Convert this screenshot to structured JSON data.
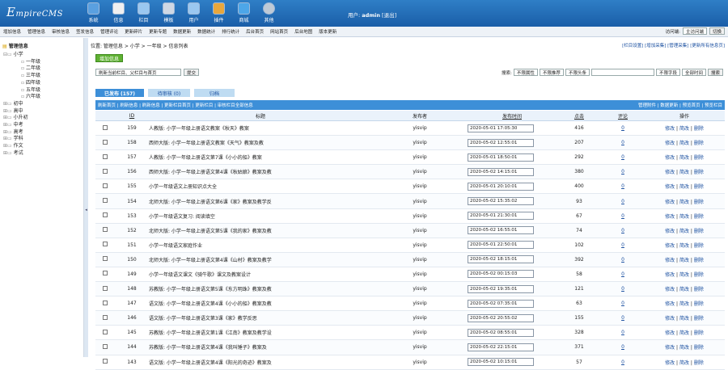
{
  "header": {
    "logo_main": "E",
    "logo_rest": "mpireCMS",
    "nav": [
      {
        "label": "系统",
        "icon": "monitor-icon"
      },
      {
        "label": "信息",
        "icon": "edit-icon"
      },
      {
        "label": "栏目",
        "icon": "folder-icon"
      },
      {
        "label": "模板",
        "icon": "template-icon"
      },
      {
        "label": "用户",
        "icon": "user-icon"
      },
      {
        "label": "插件",
        "icon": "tools-icon"
      },
      {
        "label": "商城",
        "icon": "cart-icon"
      },
      {
        "label": "其他",
        "icon": "gear-icon"
      }
    ],
    "user_prefix": "用户:",
    "user_name": "admin",
    "logout": "[退出]"
  },
  "subnav": {
    "items": [
      "增加信息",
      "管理信息",
      "审核信息",
      "签发信息",
      "管理评论",
      "更新碎片",
      "更新专题",
      "数据更新",
      "数据统计",
      "排行统计",
      "后台首页",
      "网站首页",
      "后台地图",
      "版本更新"
    ],
    "lang_label": "访问端:",
    "lang_value": "主访问端",
    "switch_label": "切换"
  },
  "sidebar": {
    "root": "管理信息",
    "tree": [
      {
        "label": "小学",
        "level": 0,
        "open": true
      },
      {
        "label": "一年级",
        "level": 1
      },
      {
        "label": "二年级",
        "level": 1
      },
      {
        "label": "三年级",
        "level": 1
      },
      {
        "label": "四年级",
        "level": 1
      },
      {
        "label": "五年级",
        "level": 1
      },
      {
        "label": "六年级",
        "level": 1
      },
      {
        "label": "初中",
        "level": 0
      },
      {
        "label": "高中",
        "level": 0
      },
      {
        "label": "小升初",
        "level": 0
      },
      {
        "label": "中考",
        "level": 0
      },
      {
        "label": "高考",
        "level": 0
      },
      {
        "label": "学科",
        "level": 0
      },
      {
        "label": "作文",
        "level": 0
      },
      {
        "label": "考试",
        "level": 0
      }
    ]
  },
  "main": {
    "breadcrumb": "位置: 管理信息 > 小学 > 一年级 > 信息列表",
    "top_links": "[栏目设置] [增加采集] [管理采集] [更新所有信息页]",
    "add_button": "增加信息",
    "filter_select": "刷新当前栏目、父栏目与首页",
    "filter_submit": "提交",
    "search": {
      "label": "搜索:",
      "sel1": "不限属性",
      "sel2": "不限推荐",
      "sel3": "不限头条",
      "field_sel": "不限字段",
      "time_sel": "全部时间",
      "button": "搜索"
    },
    "tabs": [
      {
        "label": "已发布 (157)",
        "active": true
      },
      {
        "label": "待审核 (0)",
        "active": false
      },
      {
        "label": "归档",
        "active": false
      }
    ],
    "actions_left": "刷新首页 | 刷新信息 | 刷新信息 | 更新栏目首页 | 更新栏目 | 审核栏目全部信息",
    "actions_right": "管理附件 | 数据更新 | 预览首页 | 预览栏目",
    "columns": [
      "ID",
      "标题",
      "发布者",
      "发布时间",
      "点击",
      "评论",
      "操作"
    ],
    "rows": [
      {
        "id": "159",
        "title": "人教版: 小学一年级上册语文教案《秋天》教案",
        "pub": "yisvip",
        "time": "2020-05-01 17:05:30",
        "hits": "416",
        "cm": "0"
      },
      {
        "id": "158",
        "title": "西师大版: 小学一年级上册语文教案《天气》教案及教",
        "pub": "yisvip",
        "time": "2020-05-02 12:55:01",
        "hits": "207",
        "cm": "0"
      },
      {
        "id": "157",
        "title": "人教版: 小学一年级上册语文第7课《小小的船》教案",
        "pub": "yisvip",
        "time": "2020-05-01 18:50:01",
        "hits": "292",
        "cm": "0"
      },
      {
        "id": "156",
        "title": "西师大版: 小学一年级上册语文第4课《秋姑娘》教案及教",
        "pub": "yisvip",
        "time": "2020-05-02 14:15:01",
        "hits": "380",
        "cm": "0"
      },
      {
        "id": "155",
        "title": "小学一年级语文上册知识点大全",
        "pub": "yisvip",
        "time": "2020-05-01 20:10:01",
        "hits": "400",
        "cm": "0"
      },
      {
        "id": "154",
        "title": "北师大版: 小学一年级上册语文第6课《家》教案及教学反",
        "pub": "yisvip",
        "time": "2020-05-02 15:35:02",
        "hits": "93",
        "cm": "0"
      },
      {
        "id": "153",
        "title": "小学一年级语文复习: 阅读填空",
        "pub": "yisvip",
        "time": "2020-05-01 21:30:01",
        "hits": "67",
        "cm": "0"
      },
      {
        "id": "152",
        "title": "北师大版: 小学一年级上册语文第5课《我的家》教案及教",
        "pub": "yisvip",
        "time": "2020-05-02 16:55:01",
        "hits": "74",
        "cm": "0"
      },
      {
        "id": "151",
        "title": "小学一年级语文家庭作业",
        "pub": "yisvip",
        "time": "2020-05-01 22:50:01",
        "hits": "102",
        "cm": "0"
      },
      {
        "id": "150",
        "title": "北师大版: 小学一年级上册语文第4课《山村》教案及教学",
        "pub": "yisvip",
        "time": "2020-05-02 18:15:01",
        "hits": "392",
        "cm": "0"
      },
      {
        "id": "149",
        "title": "小学一年级语文课文《骑牛歌》课文及教案设计",
        "pub": "yisvip",
        "time": "2020-05-02 00:15:03",
        "hits": "58",
        "cm": "0"
      },
      {
        "id": "148",
        "title": "苏教版: 小学一年级上册语文第5课《东方明珠》教案及教",
        "pub": "yisvip",
        "time": "2020-05-02 19:35:01",
        "hits": "121",
        "cm": "0"
      },
      {
        "id": "147",
        "title": "语文版: 小学一年级上册语文第4课《小小的船》教案及教",
        "pub": "yisvip",
        "time": "2020-05-02 07:35:01",
        "hits": "63",
        "cm": "0"
      },
      {
        "id": "146",
        "title": "语文版: 小学一年级上册语文第3课《家》教学反思",
        "pub": "yisvip",
        "time": "2020-05-02 20:55:02",
        "hits": "155",
        "cm": "0"
      },
      {
        "id": "145",
        "title": "苏教版: 小学一年级上册语文第1课《江南》教案及教学设",
        "pub": "yisvip",
        "time": "2020-05-02 08:55:01",
        "hits": "328",
        "cm": "0"
      },
      {
        "id": "144",
        "title": "苏教版: 小学一年级上册语文第4课《我叫锤子》教案及",
        "pub": "yisvip",
        "time": "2020-05-02 22:15:01",
        "hits": "371",
        "cm": "0"
      },
      {
        "id": "143",
        "title": "语文版: 小学一年级上册语文第4课《阳光的奇迹》教案及",
        "pub": "yisvip",
        "time": "2020-05-02 10:15:01",
        "hits": "57",
        "cm": "0"
      }
    ],
    "row_ops": [
      "修改",
      "简改",
      "删除"
    ]
  }
}
